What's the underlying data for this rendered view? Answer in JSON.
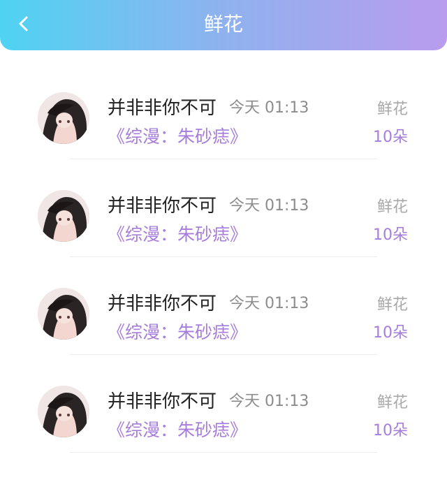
{
  "header": {
    "title": "鲜花",
    "back_icon": "chevron-left-icon",
    "gradient": [
      "#4fd3f2",
      "#b99cee"
    ]
  },
  "records": [
    {
      "name": "并非非你不可",
      "time": "今天 01:13",
      "book": "《综漫：朱砂痣》",
      "gift": "鲜花",
      "count": "10朵"
    },
    {
      "name": "并非非你不可",
      "time": "今天 01:13",
      "book": "《综漫：朱砂痣》",
      "gift": "鲜花",
      "count": "10朵"
    },
    {
      "name": "并非非你不可",
      "time": "今天 01:13",
      "book": "《综漫：朱砂痣》",
      "gift": "鲜花",
      "count": "10朵"
    },
    {
      "name": "并非非你不可",
      "time": "今天 01:13",
      "book": "《综漫：朱砂痣》",
      "gift": "鲜花",
      "count": "10朵"
    }
  ],
  "colors": {
    "accent": "#a77ddc",
    "muted": "#8c8c8c",
    "text": "#222222"
  }
}
